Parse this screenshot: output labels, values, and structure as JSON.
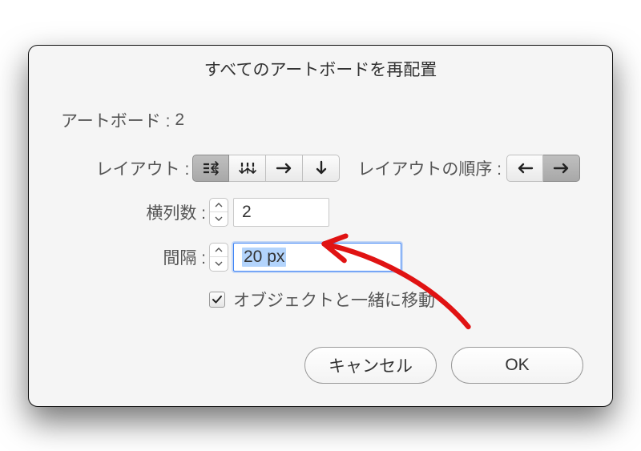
{
  "title": "すべてのアートボードを再配置",
  "artboard": {
    "label": "アートボード :",
    "count": "2"
  },
  "layout": {
    "label": "レイアウト :",
    "order_label": "レイアウトの順序 :",
    "icons": [
      "grid-row",
      "grid-column",
      "arrange-right",
      "arrange-down"
    ],
    "order_icons": [
      "order-left",
      "order-right"
    ]
  },
  "columns": {
    "label": "横列数 :",
    "value": "2"
  },
  "spacing": {
    "label": "間隔 :",
    "value": "20 px"
  },
  "checkbox": {
    "label": "オブジェクトと一緒に移動",
    "checked": true
  },
  "buttons": {
    "cancel": "キャンセル",
    "ok": "OK"
  }
}
